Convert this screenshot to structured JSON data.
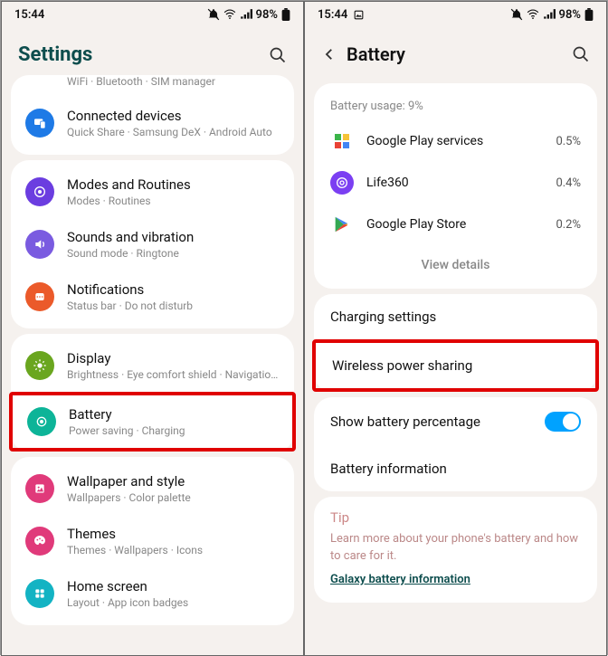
{
  "status": {
    "time": "15:44",
    "battery_pct": "98%"
  },
  "left": {
    "title": "Settings",
    "partial_sub": "WiFi · Bluetooth · SIM manager",
    "items": [
      {
        "title": "Connected devices",
        "sub": "Quick Share · Samsung DeX · Android Auto",
        "color": "#1e7ae6"
      },
      {
        "title": "Modes and Routines",
        "sub": "Modes · Routines",
        "color": "#6b3de0"
      },
      {
        "title": "Sounds and vibration",
        "sub": "Sound mode · Ringtone",
        "color": "#7a5be0"
      },
      {
        "title": "Notifications",
        "sub": "Status bar · Do not disturb",
        "color": "#eb5a2a"
      },
      {
        "title": "Display",
        "sub": "Brightness · Eye comfort shield · Navigation bar",
        "color": "#6aa61f"
      },
      {
        "title": "Battery",
        "sub": "Power saving · Charging",
        "color": "#0db498"
      },
      {
        "title": "Wallpaper and style",
        "sub": "Wallpapers · Color palette",
        "color": "#e03a7a"
      },
      {
        "title": "Themes",
        "sub": "Themes · Wallpapers · Icons",
        "color": "#e03a7a"
      },
      {
        "title": "Home screen",
        "sub": "Layout · App icon badges",
        "color": "#13b3c3"
      }
    ]
  },
  "right": {
    "title": "Battery",
    "usage_header": "Battery usage: 9%",
    "apps": [
      {
        "name": "Google Play services",
        "pct": "0.5%"
      },
      {
        "name": "Life360",
        "pct": "0.4%"
      },
      {
        "name": "Google Play Store",
        "pct": "0.2%"
      }
    ],
    "view_details": "View details",
    "settings": {
      "charging": "Charging settings",
      "wireless": "Wireless power sharing",
      "show_pct": "Show battery percentage",
      "info": "Battery information"
    },
    "tip": {
      "title": "Tip",
      "body": "Learn more about your phone's battery and how to care for it.",
      "link": "Galaxy battery information"
    }
  }
}
